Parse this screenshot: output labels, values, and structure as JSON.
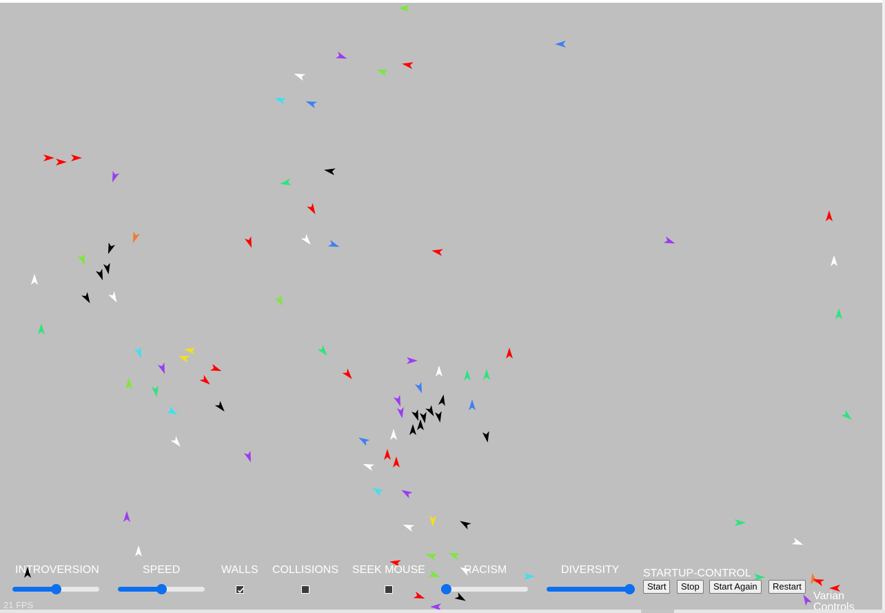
{
  "controls": {
    "introversion": {
      "label": "INTROVERSION",
      "value": 0.5
    },
    "speed": {
      "label": "SPEED",
      "value": 0.5
    },
    "walls": {
      "label": "WALLS",
      "checked": true
    },
    "collisions": {
      "label": "COLLISIONS",
      "checked": false
    },
    "seek_mouse": {
      "label": "SEEK MOUSE",
      "checked": false
    },
    "racism": {
      "label": "RACISM",
      "value": 0.0
    },
    "diversity": {
      "label": "DIVERSITY",
      "value": 1.0
    },
    "startup_control": {
      "label": "STARTUP-CONTROL",
      "buttons": [
        "Start",
        "Stop",
        "Start Again",
        "Restart"
      ]
    }
  },
  "fps_text": "21 FPS",
  "varian_controls_label": "Varian Controls",
  "colors": {
    "background": "#bfbfbf",
    "slider_accent": "#0b6ff0",
    "boid_palette": [
      "#ff0000",
      "#000000",
      "#ffffff",
      "#9b3cf0",
      "#3f7ff2",
      "#3ee0f0",
      "#7be83a",
      "#2ee37e",
      "#f07a30",
      "#f0e020"
    ]
  },
  "icons": {
    "checkbox_checked": "check-icon"
  }
}
